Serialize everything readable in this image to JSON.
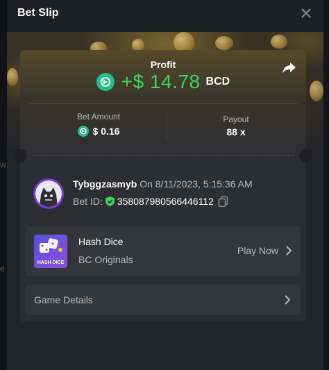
{
  "modal": {
    "title": "Bet Slip"
  },
  "profit": {
    "label": "Profit",
    "amount": "+$ 14.78",
    "currency": "BCD"
  },
  "stats": {
    "bet_amount_label": "Bet Amount",
    "bet_amount_value": "$ 0.16",
    "payout_label": "Payout",
    "payout_value": "88 x"
  },
  "bet": {
    "username": "Tybggzasmyb",
    "on_text": "On 8/11/2023, 5:15:36 AM",
    "bet_id_label": "Bet ID:",
    "bet_id": "358087980566446112"
  },
  "game": {
    "name": "Hash Dice",
    "provider": "BC Originals",
    "play_label": "Play Now",
    "thumb_label": "HASH DICE"
  },
  "details": {
    "label": "Game Details"
  },
  "background": {
    "left_fragment_1": "w",
    "left_fragment_2": "e"
  },
  "colors": {
    "profit_green": "#3fd35b",
    "coin_teal": "#1fc089",
    "avatar_purple": "#7a39d6",
    "panel_bg": "#2d2e33"
  },
  "icons": [
    "close-icon",
    "share-icon",
    "bcd-coin-icon",
    "verified-shield-icon",
    "copy-icon",
    "chevron-right-icon"
  ]
}
